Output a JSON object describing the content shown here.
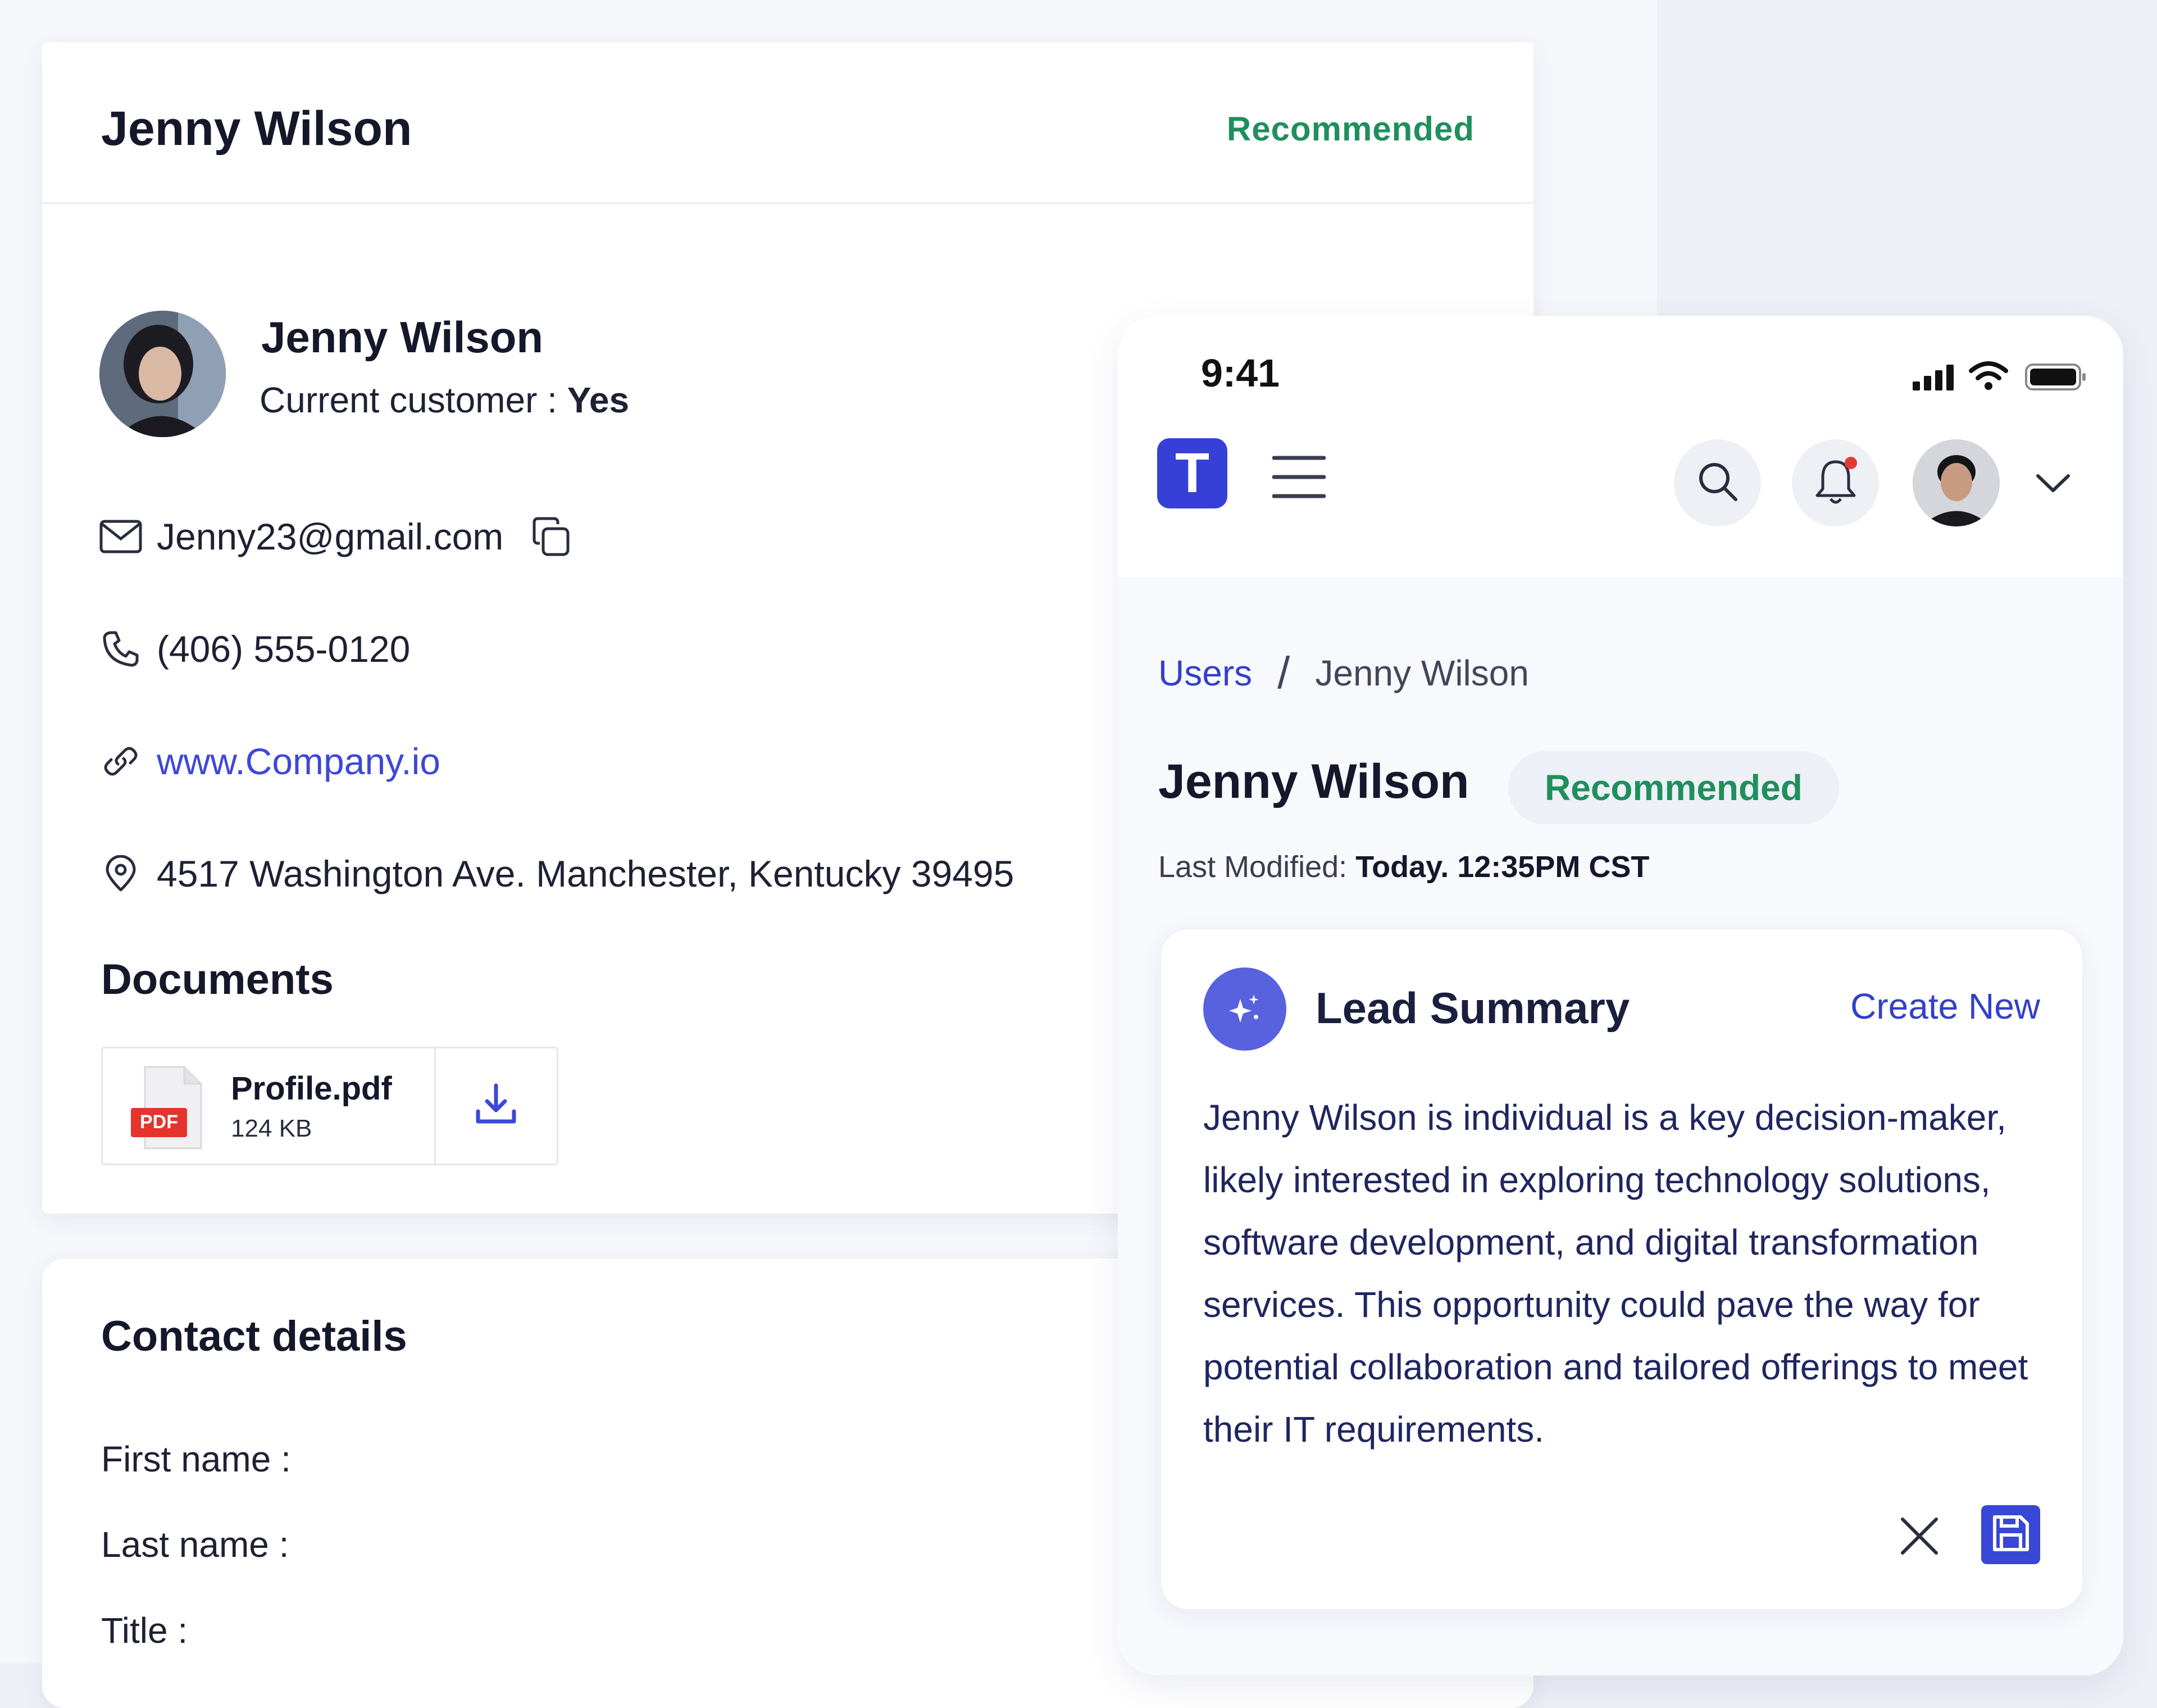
{
  "profile": {
    "header_name": "Jenny Wilson",
    "header_badge": "Recommended",
    "name": "Jenny Wilson",
    "customer_label": "Current customer :",
    "customer_value": "Yes",
    "email": "Jenny23@gmail.com",
    "phone": "(406) 555-0120",
    "website": "www.Company.io",
    "address": "4517 Washington Ave. Manchester, Kentucky 39495",
    "documents_title": "Documents",
    "document": {
      "badge": "PDF",
      "name": "Profile.pdf",
      "size": "124 KB"
    },
    "accent": "#3d48d8",
    "badge_color": "#1f8f5c"
  },
  "contact": {
    "title": "Contact details",
    "first_name_label": "First name :",
    "last_name_label": "Last name :",
    "title_label": "Title :"
  },
  "mobile": {
    "time": "9:41",
    "logo_letter": "T",
    "breadcrumb": {
      "link": "Users",
      "separator": "/",
      "current": "Jenny Wilson"
    },
    "title": "Jenny Wilson",
    "badge": "Recommended",
    "modified_label": "Last Modified:",
    "modified_value": "Today. 12:35PM CST",
    "lead": {
      "title": "Lead Summary",
      "create_new": "Create New",
      "text": "Jenny Wilson is  individual is a key decision-maker, likely interested in exploring technology solutions, software development, and digital transformation services. This opportunity could pave the way for potential collaboration and tailored offerings to meet their IT requirements."
    }
  }
}
